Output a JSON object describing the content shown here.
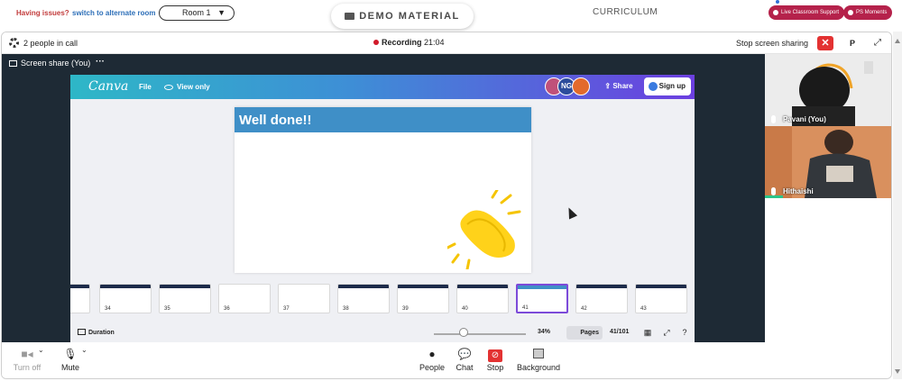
{
  "topbar": {
    "issues_text": "Having issues?",
    "switch_link": "switch to alternate room",
    "room_select": "Room 1",
    "demo_button": "DEMO MATERIAL",
    "curriculum": "CURRICULUM",
    "live_support": "Live Classroom Support",
    "ps_moments": "PS Moments"
  },
  "call": {
    "people_count": "2 people in call",
    "recording_label": "Recording",
    "recording_time": "21:04",
    "stop_sharing": "Stop screen sharing",
    "p_button": "P",
    "share_label": "Screen share (You)",
    "share_menu": "···"
  },
  "canva": {
    "logo": "Canva",
    "file_menu": "File",
    "view_only": "View only",
    "avatar_initials": "NG",
    "share_button": "Share",
    "signup_button": "Sign up",
    "slide_title": "Well done!!",
    "thumbnails": [
      {
        "num": "34",
        "active": false
      },
      {
        "num": "35",
        "active": false
      },
      {
        "num": "36",
        "active": false
      },
      {
        "num": "37",
        "active": false
      },
      {
        "num": "38",
        "active": false
      },
      {
        "num": "39",
        "active": false
      },
      {
        "num": "40",
        "active": false
      },
      {
        "num": "41",
        "active": true
      },
      {
        "num": "42",
        "active": false
      },
      {
        "num": "43",
        "active": false
      }
    ],
    "duration": "Duration",
    "zoom": "34%",
    "pages": "Pages",
    "page_count": "41/101"
  },
  "videos": [
    {
      "name": "Pavani (You)"
    },
    {
      "name": "Hithaishi"
    }
  ],
  "controls": {
    "turn_off": "Turn off",
    "mute": "Mute",
    "people": "People",
    "chat": "Chat",
    "stop": "Stop",
    "background": "Background"
  },
  "colors": {
    "accent_red": "#e33232",
    "canva_gradient_start": "#2eb7c7",
    "canva_gradient_end": "#6c3fe0",
    "slide_header": "#3f8fc7",
    "share_bg": "#1e2a35",
    "pill_pink": "#b5224b"
  }
}
